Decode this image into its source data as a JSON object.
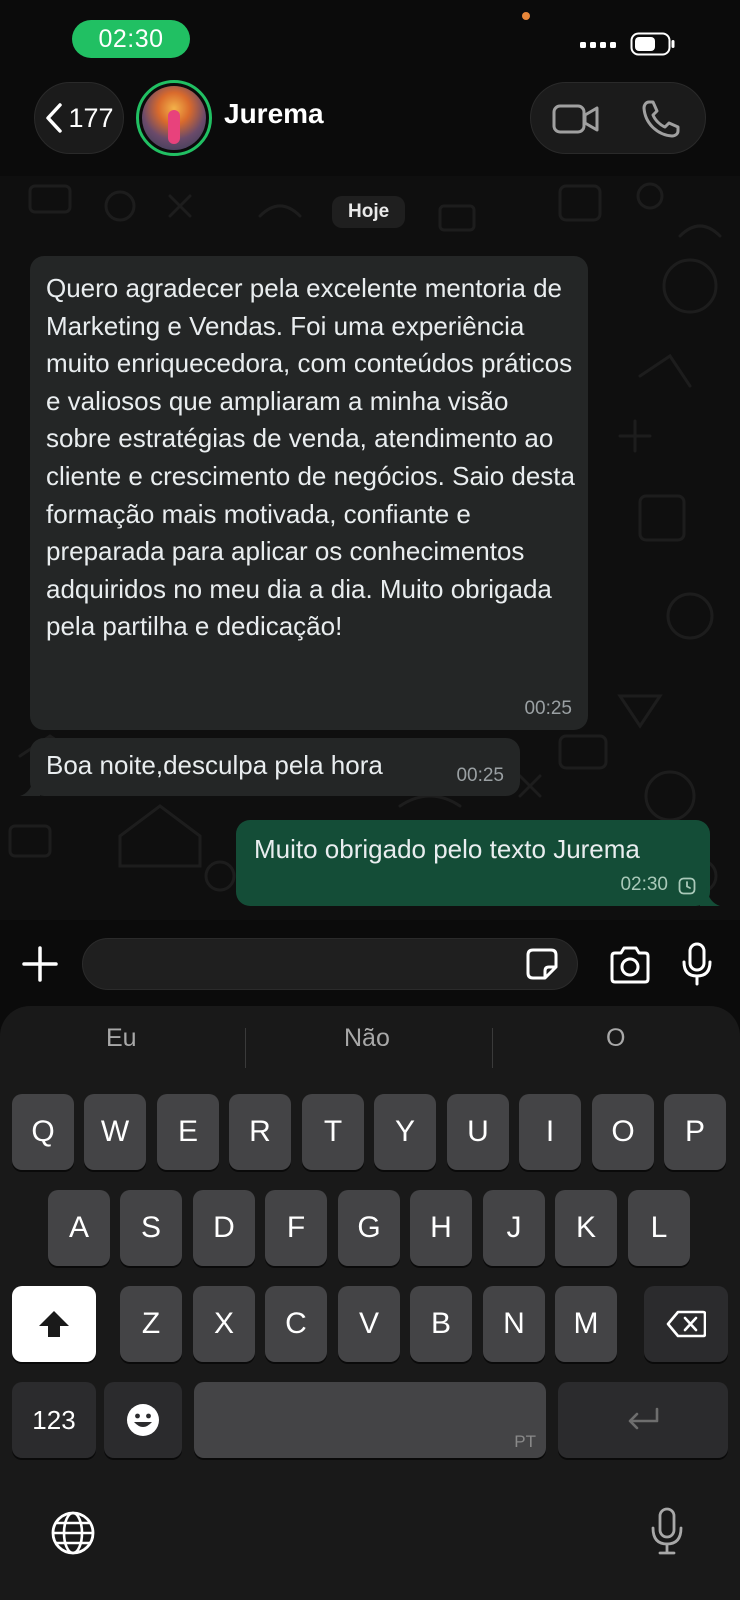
{
  "status_bar": {
    "time": "02:30"
  },
  "header": {
    "back_count": "177",
    "contact_name": "Jurema"
  },
  "chat": {
    "date_label": "Hoje",
    "messages": [
      {
        "direction": "in",
        "text": "Quero agradecer pela excelente mentoria de Marketing e Vendas. Foi uma experiência muito enriquecedora, com conteúdos práticos e valiosos que ampliaram a minha visão sobre estratégias de venda, atendimento ao cliente e crescimento de negócios. Saio desta formação mais motivada, confiante e preparada para aplicar os conhecimentos adquiridos no meu dia a dia. Muito obrigada pela partilha e dedicação!",
        "time": "00:25"
      },
      {
        "direction": "in",
        "text": "Boa noite,desculpa pela hora",
        "time": "00:25"
      },
      {
        "direction": "out",
        "text": "Muito obrigado pelo texto Jurema",
        "time": "02:30",
        "status": "pending-clock-icon"
      }
    ]
  },
  "composer": {
    "placeholder": ""
  },
  "keyboard": {
    "suggestions": [
      "Eu",
      "Não",
      "O"
    ],
    "row1": [
      "Q",
      "W",
      "E",
      "R",
      "T",
      "Y",
      "U",
      "I",
      "O",
      "P"
    ],
    "row2": [
      "A",
      "S",
      "D",
      "F",
      "G",
      "H",
      "J",
      "K",
      "L"
    ],
    "row3": [
      "Z",
      "X",
      "C",
      "V",
      "B",
      "N",
      "M"
    ],
    "numbers_label": "123",
    "space_language": "PT",
    "icons": {
      "shift": "shift-icon",
      "delete": "backspace-icon",
      "emoji": "emoji-icon",
      "return": "return-icon",
      "globe": "globe-icon",
      "dictation": "dictation-mic-icon"
    }
  },
  "colors": {
    "accent_green": "#21c063",
    "outgoing_bubble": "#144d37",
    "incoming_bubble": "#242626"
  }
}
